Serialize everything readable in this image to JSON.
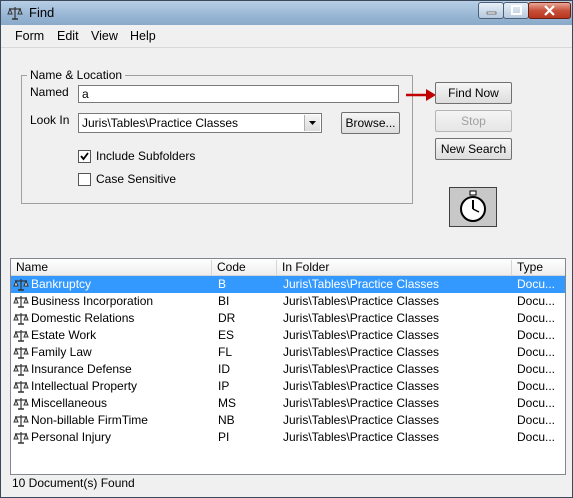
{
  "window": {
    "title": "Find"
  },
  "menu": [
    "Form",
    "Edit",
    "View",
    "Help"
  ],
  "group": {
    "title": "Name & Location"
  },
  "named": {
    "label": "Named",
    "value": "a"
  },
  "look_in": {
    "label": "Look In",
    "value": "Juris\\Tables\\Practice Classes"
  },
  "buttons": {
    "browse": "Browse...",
    "find_now": "Find Now",
    "stop": "Stop",
    "new_search": "New Search"
  },
  "checkboxes": {
    "include_subfolders": {
      "label": "Include Subfolders",
      "checked": true
    },
    "case_sensitive": {
      "label": "Case Sensitive",
      "checked": false
    }
  },
  "columns": [
    "Name",
    "Code",
    "In Folder",
    "Type"
  ],
  "rows": [
    {
      "name": "Bankruptcy",
      "code": "B",
      "folder": "Juris\\Tables\\Practice Classes",
      "type": "Docu..."
    },
    {
      "name": "Business Incorporation",
      "code": "BI",
      "folder": "Juris\\Tables\\Practice Classes",
      "type": "Docu..."
    },
    {
      "name": "Domestic Relations",
      "code": "DR",
      "folder": "Juris\\Tables\\Practice Classes",
      "type": "Docu..."
    },
    {
      "name": "Estate Work",
      "code": "ES",
      "folder": "Juris\\Tables\\Practice Classes",
      "type": "Docu..."
    },
    {
      "name": "Family Law",
      "code": "FL",
      "folder": "Juris\\Tables\\Practice Classes",
      "type": "Docu..."
    },
    {
      "name": "Insurance Defense",
      "code": "ID",
      "folder": "Juris\\Tables\\Practice Classes",
      "type": "Docu..."
    },
    {
      "name": "Intellectual Property",
      "code": "IP",
      "folder": "Juris\\Tables\\Practice Classes",
      "type": "Docu..."
    },
    {
      "name": "Miscellaneous",
      "code": "MS",
      "folder": "Juris\\Tables\\Practice Classes",
      "type": "Docu..."
    },
    {
      "name": "Non-billable FirmTime",
      "code": "NB",
      "folder": "Juris\\Tables\\Practice Classes",
      "type": "Docu..."
    },
    {
      "name": "Personal Injury",
      "code": "PI",
      "folder": "Juris\\Tables\\Practice Classes",
      "type": "Docu..."
    }
  ],
  "selected_row": 0,
  "status": "10 Document(s) Found",
  "icons": {
    "title": "scales-icon",
    "row": "scales-icon",
    "animation": "stopwatch-icon",
    "arrow": "red-arrow-icon"
  },
  "colors": {
    "selection": "#3399ff",
    "arrow": "#c00000"
  }
}
